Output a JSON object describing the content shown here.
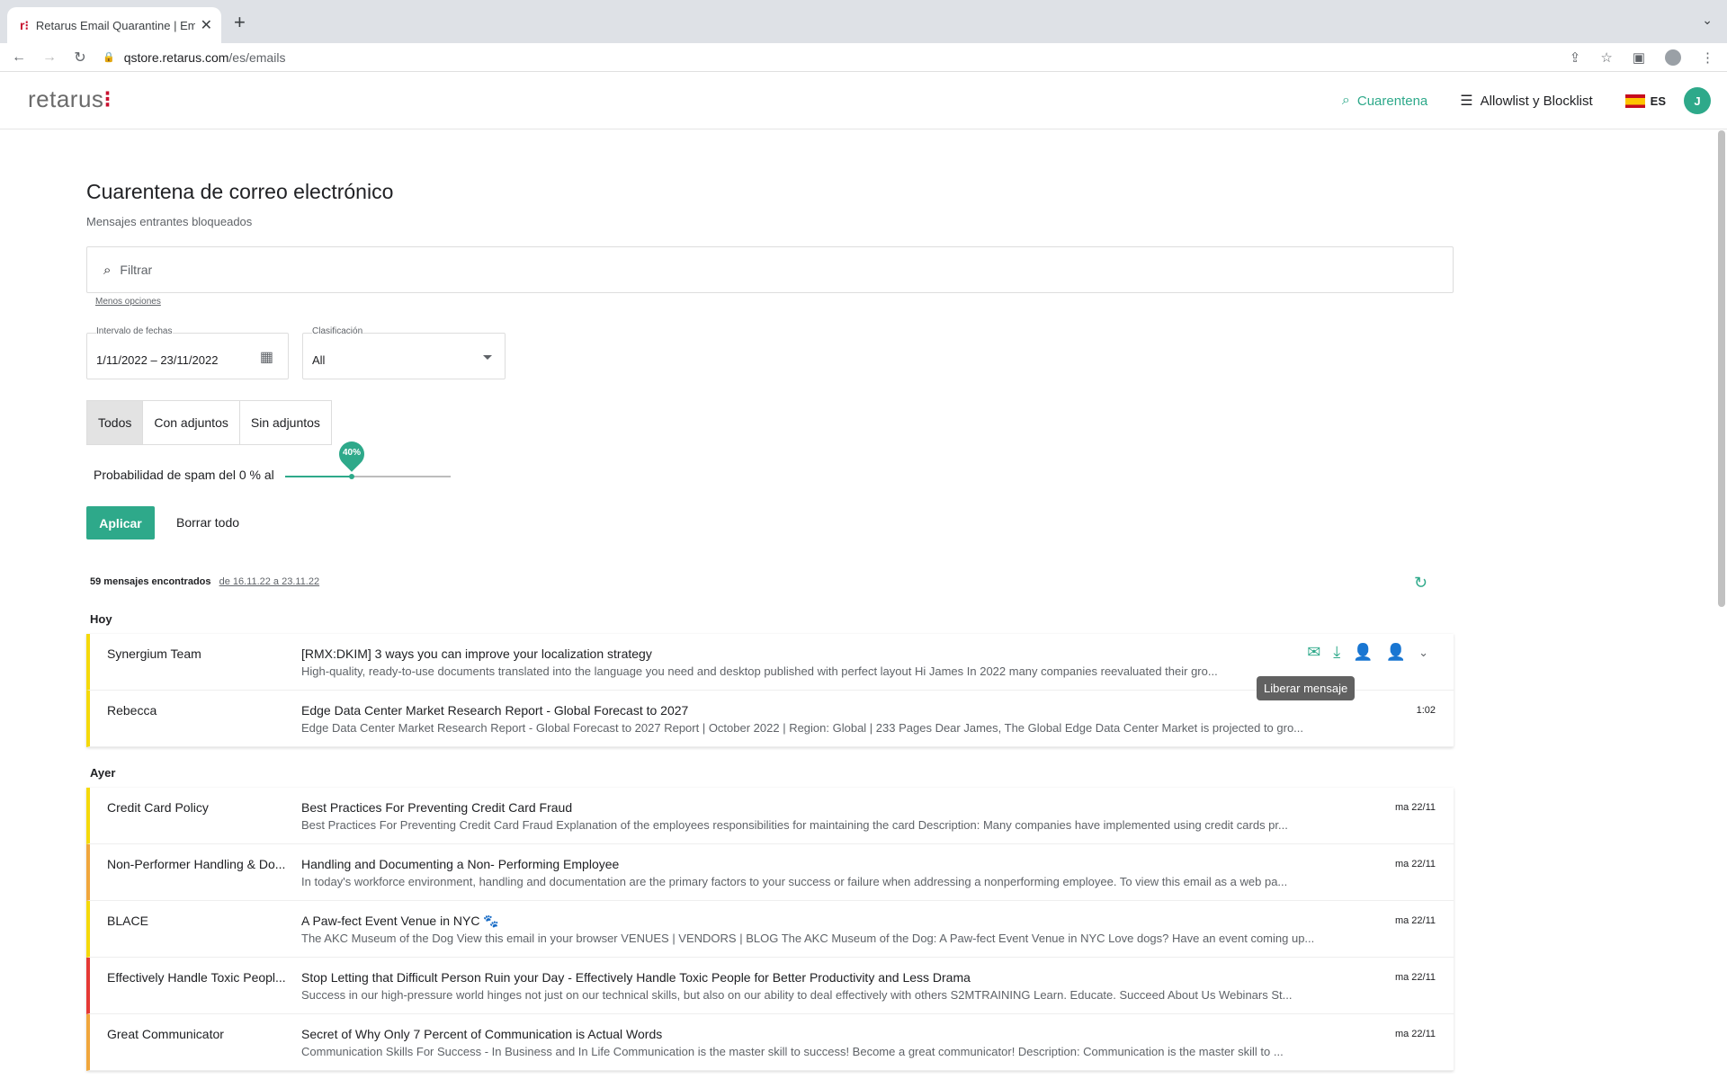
{
  "browser": {
    "tab_title": "Retarus Email Quarantine | Email",
    "favicon": "r⁝",
    "url_host": "qstore.retarus.com",
    "url_path": "/es/emails"
  },
  "app": {
    "logo": "retarus",
    "logo_dots": "⁝",
    "nav": {
      "quarantine": "Cuarentena",
      "lists": "Allowlist y Blocklist",
      "lang": "ES",
      "avatar": "J"
    }
  },
  "page": {
    "title": "Cuarentena de correo electrónico",
    "subtitle": "Mensajes entrantes bloqueados",
    "search_placeholder": "Filtrar",
    "less_options": "Menos opciones",
    "date_label": "Intervalo de fechas",
    "date_value": "1/11/2022 – 23/11/2022",
    "class_label": "Clasificación",
    "class_value": "All",
    "segments": [
      "Todos",
      "Con adjuntos",
      "Sin adjuntos"
    ],
    "spam_label": "Probabilidad de spam del 0 % al",
    "spam_value_text": "40%",
    "spam_fraction": 0.4,
    "apply": "Aplicar",
    "clear": "Borrar todo",
    "found_count": "59 mensajes encontrados",
    "found_range": "de 16.11.22 a 23.11.22",
    "tooltip": "Liberar mensaje"
  },
  "groups": {
    "today": {
      "label": "Hoy",
      "rows": [
        {
          "sender": "Synergium Team",
          "subject": "[RMX:DKIM] 3 ways you can improve your localization strategy",
          "preview": "High-quality, ready-to-use documents translated into the language you need and desktop published with perfect layout Hi James In 2022 many companies reevaluated their gro...",
          "date": ""
        },
        {
          "sender": "Rebecca",
          "subject": "Edge Data Center Market Research Report - Global Forecast to 2027",
          "preview": "Edge Data Center Market Research Report - Global Forecast to 2027 Report | October 2022 | Region: Global | 233 Pages Dear James, The Global Edge Data Center Market is projected to gro...",
          "date": "1:02"
        }
      ]
    },
    "yesterday": {
      "label": "Ayer",
      "rows": [
        {
          "sender": "Credit Card Policy",
          "subject": "Best Practices For Preventing Credit Card Fraud",
          "preview": "Best Practices For Preventing Credit Card Fraud Explanation of the employees responsibilities for maintaining the card  Description: Many companies have implemented using credit cards pr...",
          "date": "ma 22/11"
        },
        {
          "sender": "Non-Performer Handling & Do...",
          "subject": "Handling and Documenting a Non- Performing Employee",
          "preview": "In today's workforce environment, handling and documentation are the primary factors to your success or failure when addressing a nonperforming employee. To view this email as a web pa...",
          "date": "ma 22/11"
        },
        {
          "sender": "BLACE",
          "subject": "A Paw-fect Event Venue in NYC 🐾",
          "preview": "The AKC Museum of the Dog View this email in your browser VENUES | VENDORS | BLOG The AKC Museum of the Dog: A Paw-fect Event Venue in NYC Love dogs? Have an event coming up...",
          "date": "ma 22/11"
        },
        {
          "sender": "Effectively Handle Toxic Peopl...",
          "subject": "Stop Letting that Difficult Person Ruin your Day - Effectively Handle Toxic People for Better Productivity and Less Drama",
          "preview": "Success in our high-pressure world hinges not just on our technical skills, but also on our ability to deal effectively with others S2MTRAINING Learn. Educate. Succeed About Us Webinars St...",
          "date": "ma 22/11"
        },
        {
          "sender": "Great Communicator",
          "subject": "Secret of Why Only 7 Percent of Communication is Actual Words",
          "preview": "Communication Skills For Success - In Business and In Life Communication is the master skill to success! Become a great communicator!  Description: Communication is the master skill to ...",
          "date": "ma 22/11"
        }
      ]
    }
  },
  "colors": {
    "accent": "#2ea98a",
    "yellow": "#f5d90a",
    "orange": "#f0a63c",
    "red": "#e53935"
  }
}
